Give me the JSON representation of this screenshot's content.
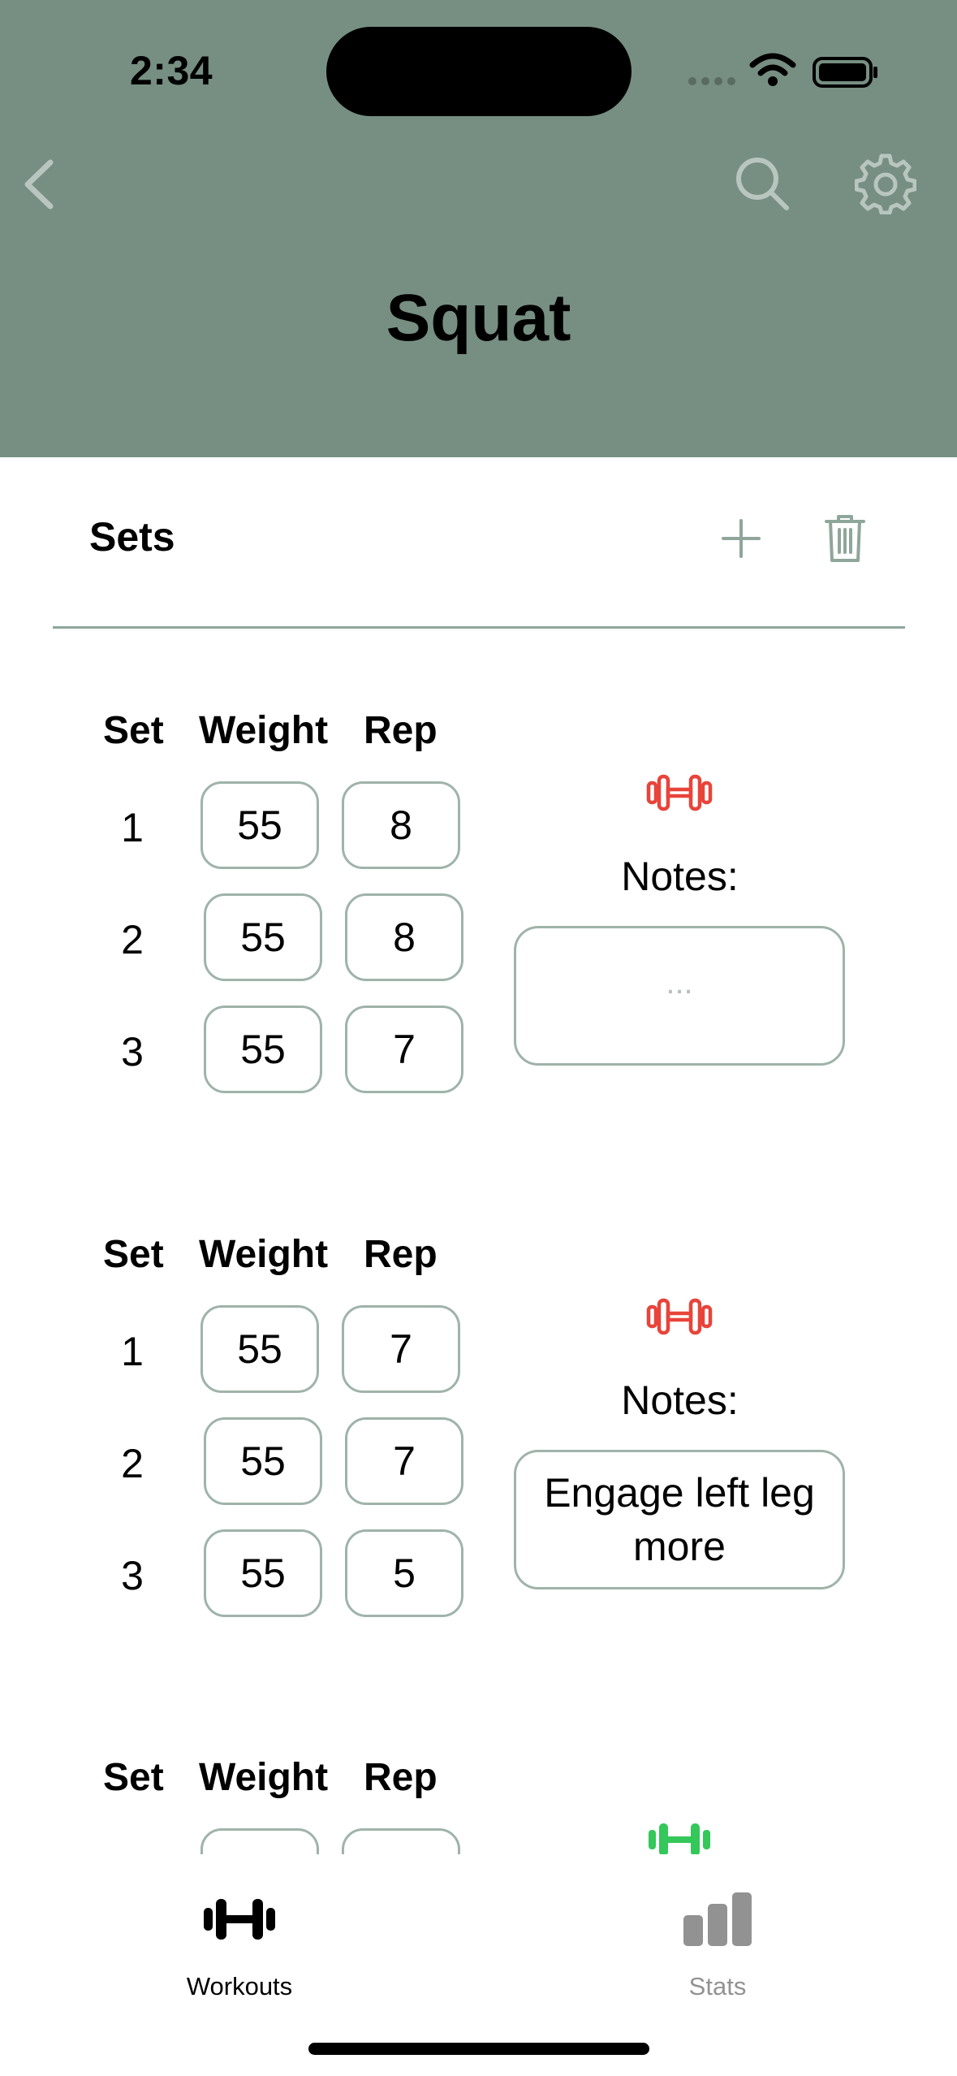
{
  "status_bar": {
    "time": "2:34"
  },
  "nav": {
    "title": "Squat",
    "back_icon": "chevron-left-icon",
    "search_icon": "search-icon",
    "settings_icon": "gear-icon",
    "header_color": "#768f82"
  },
  "sets_section": {
    "title": "Sets",
    "add_icon": "plus-icon",
    "delete_icon": "trash-icon"
  },
  "columns": {
    "set": "Set",
    "weight": "Weight",
    "rep": "Rep"
  },
  "notes_label": "Notes:",
  "exercise_blocks": [
    {
      "status_color": "#e8443a",
      "rows": [
        {
          "set": "1",
          "weight": "55",
          "reps": "8"
        },
        {
          "set": "2",
          "weight": "55",
          "reps": "8"
        },
        {
          "set": "3",
          "weight": "55",
          "reps": "7"
        }
      ],
      "notes": "",
      "notes_placeholder": "..."
    },
    {
      "status_color": "#e8443a",
      "rows": [
        {
          "set": "1",
          "weight": "55",
          "reps": "7"
        },
        {
          "set": "2",
          "weight": "55",
          "reps": "7"
        },
        {
          "set": "3",
          "weight": "55",
          "reps": "5"
        }
      ],
      "notes": "Engage left leg more"
    },
    {
      "status_color": "#34c759"
    }
  ],
  "tabbar": {
    "tabs": [
      {
        "label": "Workouts",
        "icon": "dumbbell-icon",
        "selected": true
      },
      {
        "label": "Stats",
        "icon": "bar-chart-icon",
        "selected": false
      }
    ]
  }
}
